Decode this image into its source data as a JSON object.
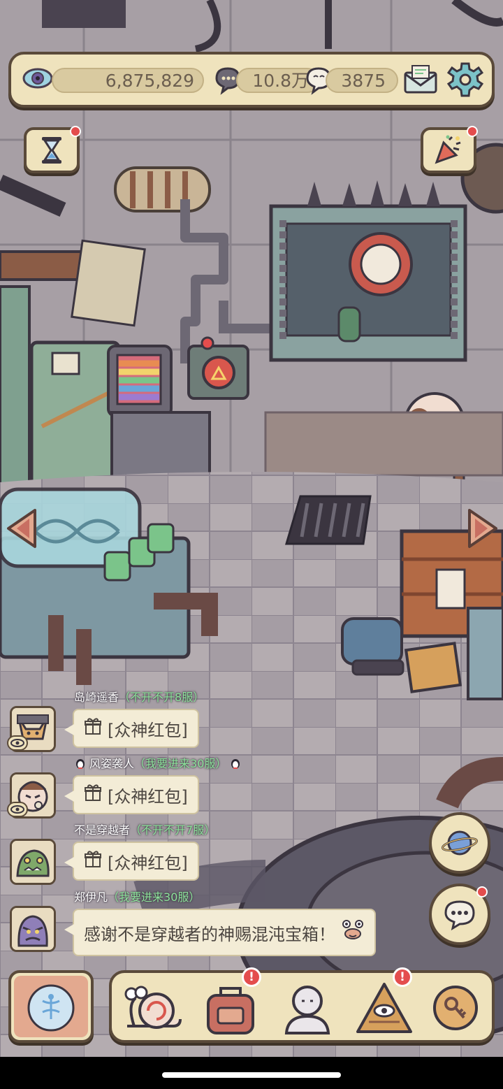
{
  "resources": {
    "eye_value": "6,875,829",
    "chat_value": "10.8万",
    "bubble_value": "3875"
  },
  "icons": {
    "eye": "eye-icon",
    "chat": "speech-bubble-icon",
    "whisper": "thought-bubble-icon",
    "mail": "mail-icon",
    "settings": "gear-icon",
    "hourglass": "hourglass-icon",
    "party": "party-popper-icon"
  },
  "chat": {
    "messages": [
      {
        "name": "岛崎遥香",
        "server": "（不开不开8服）",
        "text": "[众神红包]"
      },
      {
        "name": "风姿袭人",
        "server": "（我要进来30服）",
        "text": "[众神红包]"
      },
      {
        "name": "不是穿越者",
        "server": "（不开不开7服）",
        "text": "[众神红包]"
      },
      {
        "name": "郑伊凡",
        "server": "（我要进来30服）",
        "text": "感谢不是穿越者的神赐混沌宝箱！"
      }
    ]
  },
  "nav": {
    "items": [
      "snail",
      "backpack",
      "statue",
      "pyramid-eye",
      "key-coin"
    ]
  },
  "colors": {
    "panel": "#efe3bd",
    "outline": "#5a4a3a",
    "server_text": "#8de39b",
    "alert": "#e44d4d"
  }
}
